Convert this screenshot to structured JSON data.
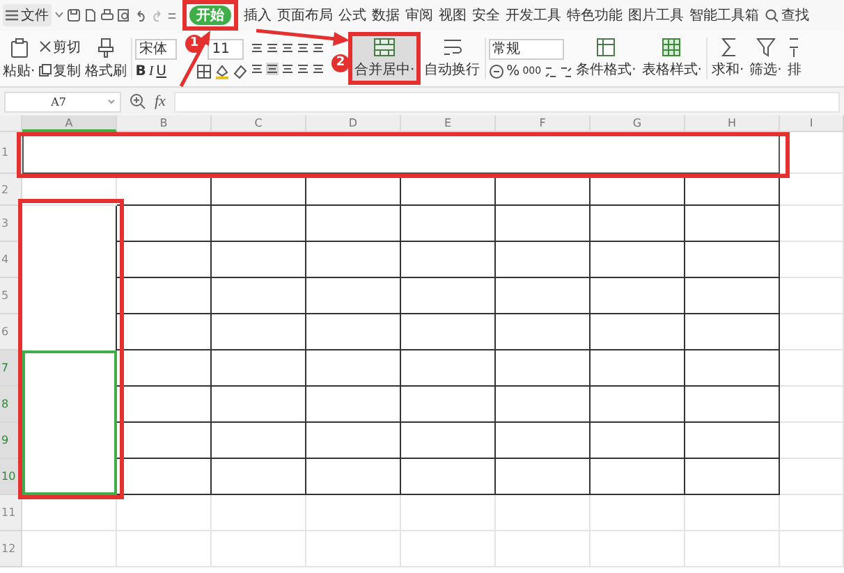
{
  "menu": {
    "file": "文件",
    "tabs": [
      {
        "label": "开始",
        "selected": true
      },
      {
        "label": "插入",
        "selected": false
      },
      {
        "label": "页面布局",
        "selected": false
      },
      {
        "label": "公式",
        "selected": false
      },
      {
        "label": "数据",
        "selected": false
      },
      {
        "label": "审阅",
        "selected": false
      },
      {
        "label": "视图",
        "selected": false
      },
      {
        "label": "安全",
        "selected": false
      },
      {
        "label": "开发工具",
        "selected": false
      },
      {
        "label": "特色功能",
        "selected": false
      },
      {
        "label": "图片工具",
        "selected": false
      },
      {
        "label": "智能工具箱",
        "selected": false
      }
    ],
    "search": "查找"
  },
  "ribbon": {
    "paste": "粘贴·",
    "cut": "剪切",
    "copy": "复制",
    "format_painter": "格式刷",
    "font": "宋体",
    "font_size": "11",
    "bold": "B",
    "italic": "I",
    "underline": "U",
    "merge_center": {
      "label": "合并居中·",
      "active": true
    },
    "wrap": "自动换行",
    "number_format": "常规",
    "percent": "%",
    "thousands": "000",
    "conditional_format": "条件格式·",
    "table_style": "表格样式·",
    "sum": "求和·",
    "filter": "筛选·",
    "sort": "排"
  },
  "formula_bar": {
    "name_box": "A7",
    "fx": "fx"
  },
  "sheet": {
    "columns": [
      {
        "label": "A",
        "selected": true
      },
      {
        "label": "B",
        "selected": false
      },
      {
        "label": "C",
        "selected": false
      },
      {
        "label": "D",
        "selected": false
      },
      {
        "label": "E",
        "selected": false
      },
      {
        "label": "F",
        "selected": false
      },
      {
        "label": "G",
        "selected": false
      },
      {
        "label": "H",
        "selected": false
      },
      {
        "label": "I",
        "selected": false
      }
    ],
    "rows": [
      {
        "label": "1",
        "selected": false
      },
      {
        "label": "2",
        "selected": false
      },
      {
        "label": "3",
        "selected": false
      },
      {
        "label": "4",
        "selected": false
      },
      {
        "label": "5",
        "selected": false
      },
      {
        "label": "6",
        "selected": false
      },
      {
        "label": "7",
        "selected": true
      },
      {
        "label": "8",
        "selected": true
      },
      {
        "label": "9",
        "selected": true
      },
      {
        "label": "10",
        "selected": true
      },
      {
        "label": "11",
        "selected": false
      },
      {
        "label": "12",
        "selected": false
      }
    ]
  },
  "annotations": [
    {
      "label": "1"
    },
    {
      "label": "2"
    }
  ]
}
